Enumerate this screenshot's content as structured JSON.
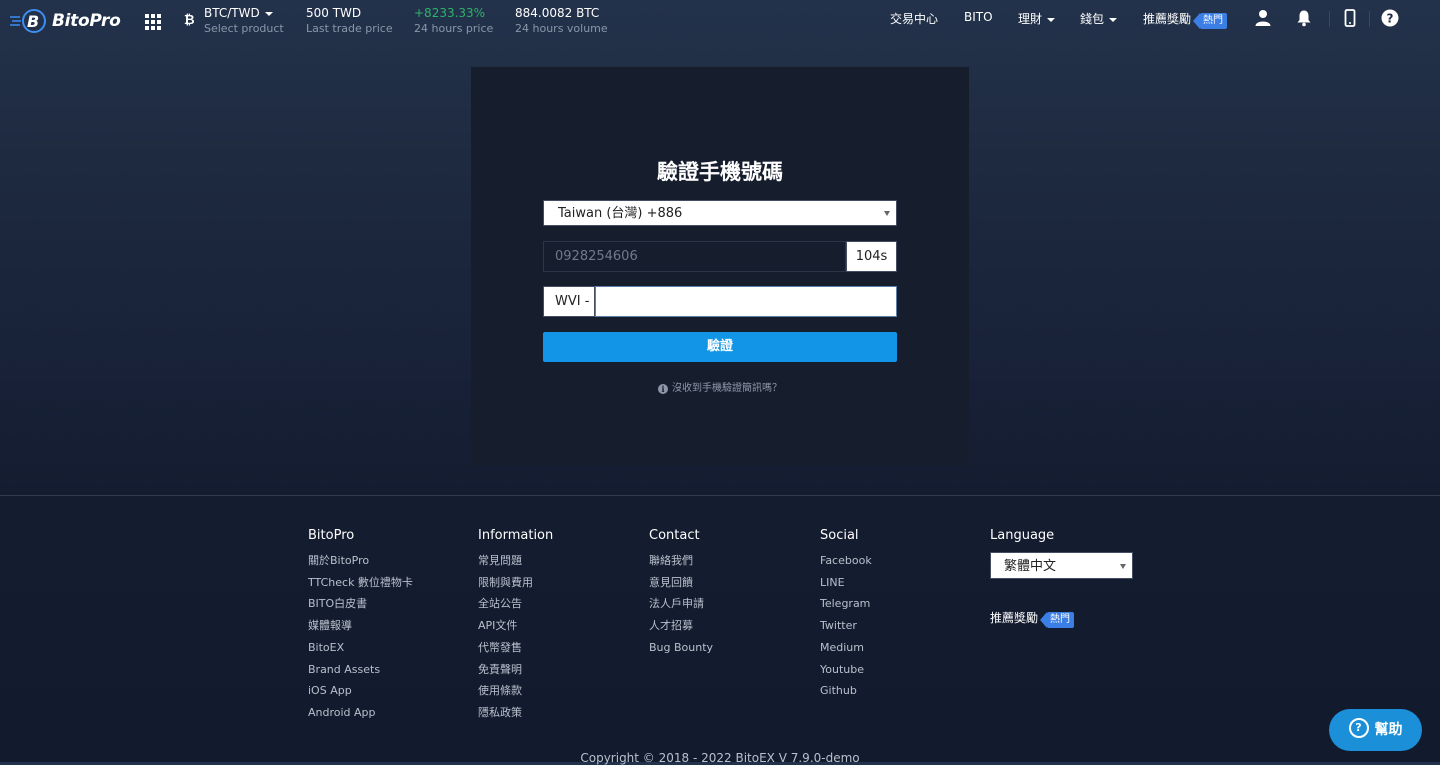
{
  "header": {
    "brand": "BitoPro",
    "pair": "BTC/TWD",
    "pair_label": "Select product",
    "last_price": "500 TWD",
    "last_price_label": "Last trade price",
    "change": "+8233.33%",
    "change_label": "24 hours price",
    "volume": "884.0082 BTC",
    "volume_label": "24 hours volume",
    "nav": {
      "trading_center": "交易中心",
      "bito": "BITO",
      "finance": "理財",
      "wallet": "錢包",
      "referral": "推薦獎勵",
      "hot": "熱門"
    },
    "colors": {
      "positive": "#2db36b",
      "hot_tag": "#3b7ee6"
    }
  },
  "verify": {
    "title": "驗證手機號碼",
    "country": "Taiwan (台灣) +886",
    "phone_value": "0928254606",
    "countdown": "104s",
    "code_prefix": "WVI -",
    "code_value": "",
    "submit": "驗證",
    "help_text": "沒收到手機驗證簡訊嗎？",
    "accent": "#1295e6"
  },
  "footer": {
    "columns": [
      {
        "heading": "BitoPro",
        "items": [
          "關於BitoPro",
          "TTCheck 數位禮物卡",
          "BITO白皮書",
          "媒體報導",
          "BitoEX",
          "Brand Assets",
          "iOS App",
          "Android App"
        ]
      },
      {
        "heading": "Information",
        "items": [
          "常見問題",
          "限制與費用",
          "全站公告",
          "API文件",
          "代幣發售",
          "免責聲明",
          "使用條款",
          "隱私政策"
        ]
      },
      {
        "heading": "Contact",
        "items": [
          "聯絡我們",
          "意見回饋",
          "法人戶申請",
          "人才招募",
          "Bug Bounty"
        ]
      },
      {
        "heading": "Social",
        "items": [
          "Facebook",
          "LINE",
          "Telegram",
          "Twitter",
          "Medium",
          "Youtube",
          "Github"
        ]
      }
    ],
    "language_heading": "Language",
    "language_value": "繁體中文",
    "referral": "推薦獎勵",
    "hot": "熱門",
    "copyright": "Copyright © 2018 - 2022 BitoEX  V 7.9.0-demo"
  },
  "help_button": "幫助",
  "icons": [
    "bitopro-logo-icon",
    "apps-grid-icon",
    "bitcoin-icon",
    "user-icon",
    "bell-icon",
    "mobile-icon",
    "question-icon",
    "info-icon"
  ]
}
